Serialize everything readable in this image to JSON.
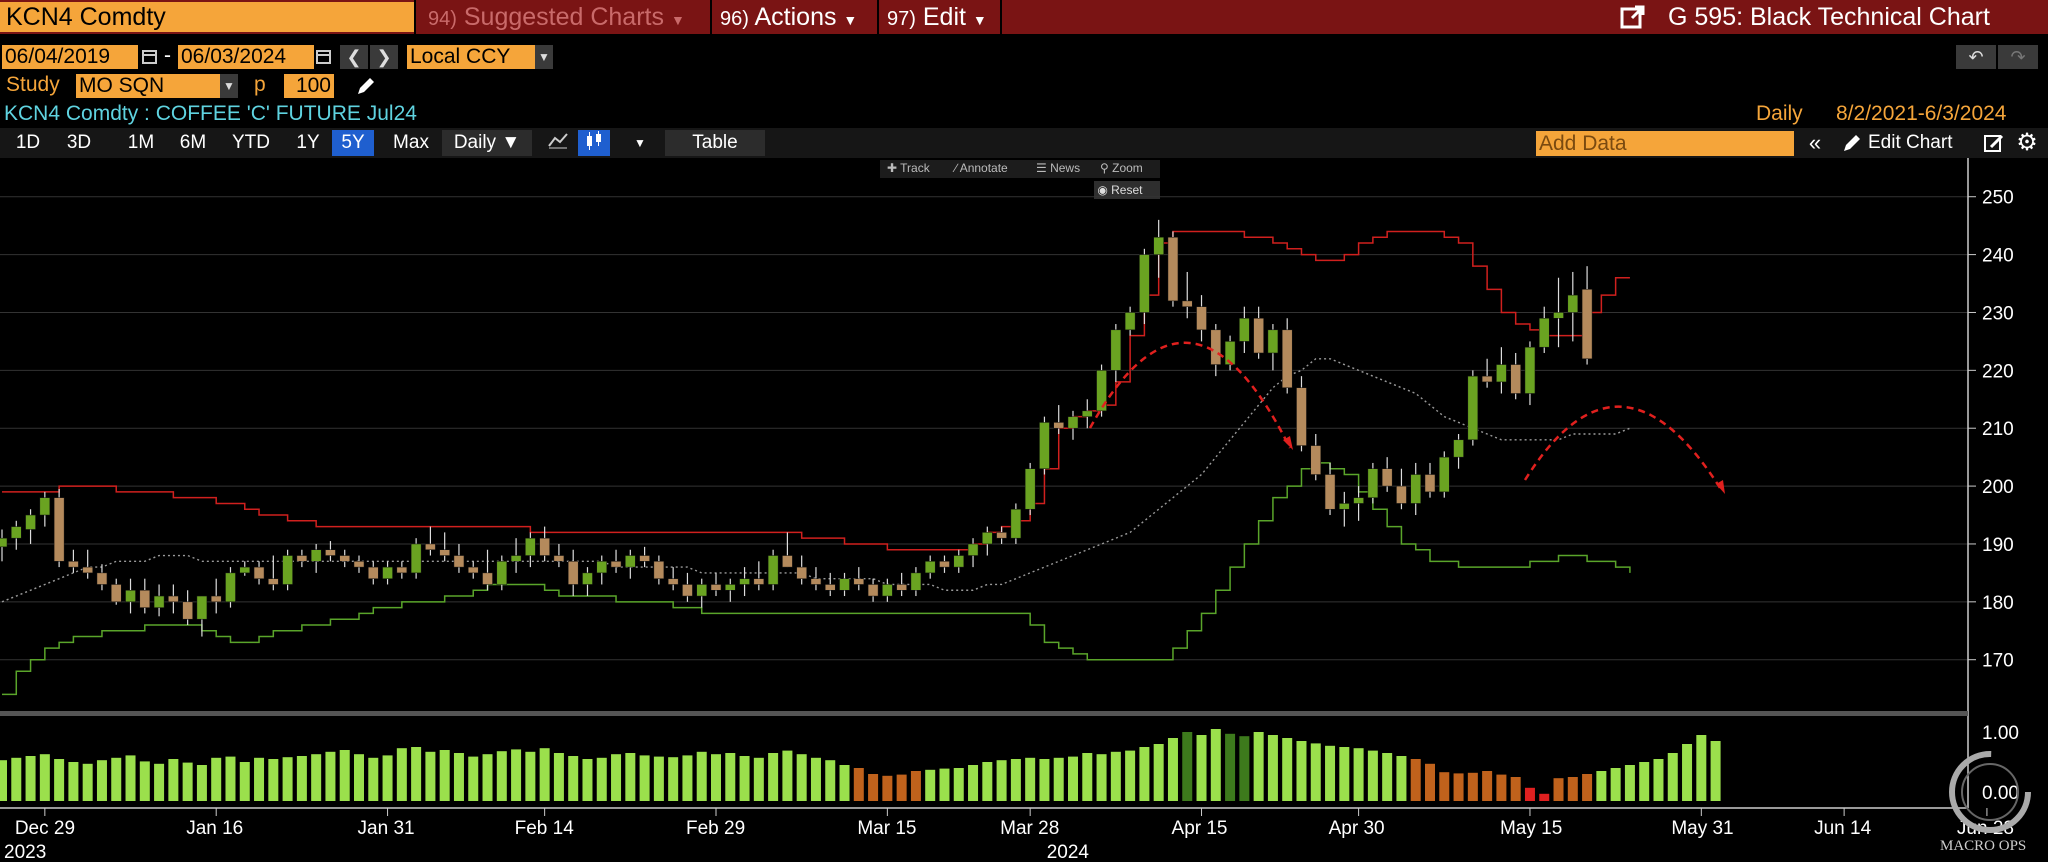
{
  "header": {
    "ticker": "KCN4 Comdty",
    "suggested_num": "94)",
    "suggested_label": "Suggested Charts",
    "actions_num": "96)",
    "actions_label": "Actions",
    "edit_num": "97)",
    "edit_label": "Edit",
    "page_title": "G 595: Black Technical Chart"
  },
  "date_range": {
    "start": "06/04/2019",
    "dash": "-",
    "end": "06/03/2024",
    "currency": "Local CCY"
  },
  "study": {
    "label": "Study",
    "name": "MO SQN",
    "param_label": "p",
    "param_value": "100"
  },
  "security": {
    "description": "KCN4 Comdty : COFFEE 'C' FUTURE Jul24",
    "frequency": "Daily",
    "range": "8/2/2021-6/3/2024"
  },
  "toolbar": {
    "periods": [
      "1D",
      "3D",
      "1M",
      "6M",
      "YTD",
      "1Y",
      "5Y",
      "Max"
    ],
    "selected_period": "5Y",
    "interval": "Daily ▼",
    "table_label": "Table",
    "add_data_placeholder": "Add Data",
    "edit_chart_label": "Edit Chart"
  },
  "chart_tools": {
    "track": "Track",
    "annotate": "Annotate",
    "news": "News",
    "zoom": "Zoom",
    "reset": "Reset"
  },
  "watermark": "MACRO OPS",
  "colors": {
    "up": "#6aa321",
    "down": "#b48a5c",
    "upper_band": "#d0201e",
    "lower_band": "#5aa52a",
    "mid_line": "#9a9a9a",
    "annotation_arc": "#e0201e",
    "volume": "#9be04c",
    "volume_low": "#c0621c"
  },
  "chart_data": {
    "type": "candlestick",
    "y_axis": {
      "ticks": [
        170,
        180,
        190,
        200,
        210,
        220,
        230,
        240,
        250
      ],
      "range": [
        162,
        256
      ]
    },
    "volume_axis": {
      "ticks": [
        "1.00",
        "0.00"
      ]
    },
    "x_ticks": [
      "Dec 29",
      "Jan 16",
      "Jan 31",
      "Feb 14",
      "Feb 29",
      "Mar 15",
      "Mar 28",
      "Apr 15",
      "Apr 30",
      "May 15",
      "May 31",
      "Jun 14",
      "Jun 28"
    ],
    "x_tick_index": [
      3,
      15,
      27,
      38,
      50,
      62,
      72,
      84,
      95,
      107,
      119,
      129,
      139
    ],
    "year_labels": [
      {
        "label": "2023",
        "index": 0
      },
      {
        "label": "2024",
        "index": 74
      }
    ],
    "candles": [
      [
        189.5,
        192.5,
        187,
        191
      ],
      [
        191,
        194,
        189,
        193
      ],
      [
        192.5,
        196,
        190,
        195
      ],
      [
        195,
        199,
        193,
        198
      ],
      [
        198,
        199.5,
        186,
        187
      ],
      [
        187,
        189,
        185,
        186
      ],
      [
        186,
        189,
        184,
        185
      ],
      [
        185,
        186.5,
        182,
        183
      ],
      [
        183,
        184,
        179.5,
        180
      ],
      [
        180,
        184,
        178,
        182
      ],
      [
        182,
        184,
        178,
        179
      ],
      [
        179,
        183,
        177.5,
        181
      ],
      [
        181,
        183,
        178,
        180
      ],
      [
        180,
        182,
        176,
        177
      ],
      [
        177,
        181,
        174,
        181
      ],
      [
        181,
        184,
        178,
        180
      ],
      [
        180,
        186,
        179,
        185
      ],
      [
        185,
        187,
        184.5,
        186
      ],
      [
        186,
        187,
        183,
        184
      ],
      [
        184,
        188,
        182,
        183
      ],
      [
        183,
        189,
        182,
        188
      ],
      [
        188,
        189,
        186,
        187
      ],
      [
        187,
        190,
        185,
        189
      ],
      [
        189,
        190.5,
        187,
        188
      ],
      [
        188,
        189,
        186,
        187
      ],
      [
        187,
        188,
        185,
        186
      ],
      [
        186,
        187,
        183,
        184
      ],
      [
        184,
        187,
        183,
        186
      ],
      [
        186,
        187,
        184,
        185
      ],
      [
        185,
        191,
        184,
        190
      ],
      [
        190,
        193,
        188,
        189
      ],
      [
        189,
        192,
        187,
        188
      ],
      [
        188,
        190,
        185,
        186
      ],
      [
        186,
        187,
        184,
        185
      ],
      [
        185,
        189,
        182,
        183
      ],
      [
        183,
        188,
        182,
        187
      ],
      [
        187,
        191,
        185,
        188
      ],
      [
        188,
        192,
        186,
        191
      ],
      [
        191,
        193,
        187,
        188
      ],
      [
        188,
        190,
        186,
        187
      ],
      [
        187,
        189,
        181,
        183
      ],
      [
        183,
        186,
        181,
        185
      ],
      [
        185,
        188,
        183,
        187
      ],
      [
        187,
        189,
        185,
        186
      ],
      [
        186,
        189,
        184,
        188
      ],
      [
        188,
        189.5,
        186,
        187
      ],
      [
        187,
        188,
        183,
        184
      ],
      [
        184,
        186,
        182,
        183
      ],
      [
        183,
        185,
        180,
        181
      ],
      [
        181,
        184,
        179,
        183
      ],
      [
        183,
        185,
        181,
        182
      ],
      [
        182,
        184,
        180,
        183
      ],
      [
        183,
        186,
        181,
        184
      ],
      [
        184,
        187,
        182,
        183
      ],
      [
        183,
        189,
        182,
        188
      ],
      [
        188,
        192,
        186,
        186
      ],
      [
        186,
        188,
        183,
        184
      ],
      [
        184,
        186,
        182,
        183
      ],
      [
        183,
        185,
        181,
        182
      ],
      [
        182,
        185,
        181,
        184
      ],
      [
        184,
        186,
        182,
        183
      ],
      [
        183,
        184,
        180,
        181
      ],
      [
        181,
        184,
        180,
        183
      ],
      [
        183,
        185,
        181,
        182
      ],
      [
        182,
        186,
        181,
        185
      ],
      [
        185,
        188,
        184,
        187
      ],
      [
        187,
        188,
        185,
        186
      ],
      [
        186,
        189,
        185,
        188
      ],
      [
        188,
        191,
        186,
        190
      ],
      [
        190,
        193,
        188,
        192
      ],
      [
        192,
        193,
        190,
        191
      ],
      [
        191,
        197,
        190,
        196
      ],
      [
        196,
        204,
        195,
        203
      ],
      [
        203,
        212,
        202,
        211
      ],
      [
        211,
        214,
        209,
        210
      ],
      [
        210,
        213,
        208,
        212
      ],
      [
        212,
        215,
        210,
        213
      ],
      [
        213,
        221,
        212,
        220
      ],
      [
        220,
        228,
        218,
        227
      ],
      [
        227,
        231,
        226,
        230
      ],
      [
        230,
        241,
        228,
        240
      ],
      [
        240,
        246,
        236,
        243
      ],
      [
        243,
        244,
        231,
        232
      ],
      [
        232,
        237,
        229,
        231
      ],
      [
        231,
        233,
        225,
        227
      ],
      [
        227,
        228,
        219,
        221
      ],
      [
        221,
        226,
        220,
        225
      ],
      [
        225,
        231,
        223,
        229
      ],
      [
        229,
        231,
        222,
        223
      ],
      [
        223,
        228,
        220,
        227
      ],
      [
        227,
        229,
        216,
        217
      ],
      [
        217,
        219,
        206,
        207
      ],
      [
        207,
        209,
        201,
        202
      ],
      [
        202,
        204,
        195,
        196
      ],
      [
        196,
        199,
        193,
        197
      ],
      [
        197,
        200,
        194,
        198
      ],
      [
        198,
        204,
        197,
        203
      ],
      [
        203,
        205,
        199,
        200
      ],
      [
        200,
        203,
        196,
        197
      ],
      [
        197,
        204,
        195,
        202
      ],
      [
        202,
        204,
        198,
        199
      ],
      [
        199,
        206,
        198,
        205
      ],
      [
        205,
        209,
        203,
        208
      ],
      [
        208,
        220,
        207,
        219
      ],
      [
        219,
        222,
        217,
        218
      ],
      [
        218,
        224,
        216,
        221
      ],
      [
        221,
        223,
        215,
        216
      ],
      [
        216,
        225,
        214,
        224
      ],
      [
        224,
        231,
        223,
        229
      ],
      [
        229,
        236,
        224,
        230
      ],
      [
        230,
        237,
        225,
        233
      ],
      [
        234,
        238,
        221,
        222
      ]
    ],
    "upper_band": [
      199,
      199,
      199,
      199,
      200,
      200,
      200,
      200,
      199,
      199,
      199,
      199,
      198,
      198,
      198,
      197,
      197,
      196,
      195,
      195,
      194,
      194,
      193,
      193,
      193,
      193,
      193,
      193,
      193,
      193,
      193,
      193,
      193,
      193,
      193,
      193,
      193,
      192,
      192,
      192,
      192,
      192,
      192,
      192,
      192,
      192,
      192,
      192,
      192,
      192,
      192,
      192,
      192,
      192,
      192,
      192,
      191,
      191,
      191,
      190,
      190,
      190,
      189,
      189,
      189,
      189,
      189,
      189,
      190,
      192,
      193,
      194,
      197,
      203,
      210,
      212,
      213,
      214,
      218,
      226,
      233,
      242,
      244,
      244,
      244,
      244,
      244,
      243,
      243,
      242,
      241,
      240,
      239,
      239,
      240,
      242,
      243,
      244,
      244,
      244,
      244,
      243,
      242,
      238,
      234,
      230,
      228,
      227,
      226,
      226,
      226,
      230,
      233,
      236,
      236
    ],
    "lower_band": [
      164,
      168,
      170,
      172,
      173,
      174,
      174,
      175,
      175,
      175,
      176,
      176,
      176,
      176,
      175,
      174,
      173,
      173,
      174,
      175,
      175,
      176,
      176,
      177,
      177,
      178,
      179,
      179,
      180,
      180,
      180,
      181,
      181,
      182,
      183,
      183,
      183,
      183,
      182,
      181,
      181,
      181,
      181,
      180,
      180,
      180,
      180,
      179,
      179,
      178,
      178,
      178,
      178,
      178,
      178,
      178,
      178,
      178,
      178,
      178,
      178,
      178,
      178,
      178,
      178,
      178,
      178,
      178,
      178,
      178,
      178,
      178,
      176,
      173,
      172,
      171,
      170,
      170,
      170,
      170,
      170,
      170,
      172,
      175,
      178,
      182,
      186,
      190,
      194,
      198,
      200,
      203,
      204,
      203,
      202,
      199,
      196,
      193,
      190,
      189,
      187,
      187,
      186,
      186,
      186,
      186,
      186,
      187,
      187,
      188,
      188,
      187,
      187,
      186,
      185
    ],
    "mid_line": [
      180,
      181,
      182,
      183,
      184,
      185,
      186,
      186,
      187,
      187,
      187,
      188,
      188,
      188,
      187,
      187,
      187,
      187,
      187,
      187,
      187,
      187,
      187,
      187,
      187,
      187,
      187,
      187,
      187,
      187,
      187,
      187,
      187,
      187,
      187,
      187,
      187,
      187,
      187,
      187,
      187,
      187,
      187,
      186,
      186,
      186,
      186,
      186,
      186,
      185,
      185,
      185,
      185,
      185,
      185,
      185,
      185,
      184,
      184,
      184,
      184,
      184,
      183,
      183,
      183,
      183,
      182,
      182,
      182,
      183,
      183,
      184,
      185,
      186,
      187,
      188,
      189,
      190,
      191,
      192,
      194,
      196,
      198,
      200,
      202,
      205,
      208,
      211,
      214,
      217,
      219,
      220,
      222,
      222,
      221,
      220,
      219,
      218,
      217,
      216,
      214,
      212,
      211,
      210,
      209,
      208,
      208,
      208,
      208,
      208,
      209,
      209,
      209,
      209,
      210
    ],
    "volume": [
      0.68,
      0.72,
      0.75,
      0.78,
      0.7,
      0.65,
      0.62,
      0.68,
      0.72,
      0.76,
      0.66,
      0.62,
      0.7,
      0.64,
      0.6,
      0.72,
      0.74,
      0.65,
      0.72,
      0.7,
      0.73,
      0.75,
      0.78,
      0.82,
      0.85,
      0.78,
      0.72,
      0.76,
      0.88,
      0.9,
      0.82,
      0.85,
      0.8,
      0.74,
      0.78,
      0.83,
      0.86,
      0.82,
      0.88,
      0.8,
      0.75,
      0.7,
      0.72,
      0.78,
      0.8,
      0.76,
      0.74,
      0.73,
      0.76,
      0.82,
      0.78,
      0.8,
      0.75,
      0.72,
      0.8,
      0.84,
      0.78,
      0.72,
      0.68,
      0.6,
      0.55,
      0.45,
      0.42,
      0.44,
      0.5,
      0.52,
      0.54,
      0.55,
      0.6,
      0.65,
      0.68,
      0.7,
      0.72,
      0.7,
      0.72,
      0.74,
      0.8,
      0.78,
      0.82,
      0.84,
      0.9,
      0.95,
      1.05,
      1.15,
      1.1,
      1.2,
      1.12,
      1.08,
      1.15,
      1.1,
      1.05,
      1.0,
      0.96,
      0.92,
      0.9,
      0.88,
      0.84,
      0.8,
      0.75,
      0.7,
      0.62,
      0.48,
      0.46,
      0.47,
      0.5,
      0.44,
      0.4,
      0.22,
      0.12,
      0.38,
      0.4,
      0.45,
      0.5,
      0.55,
      0.6,
      0.65,
      0.7,
      0.8,
      0.95,
      1.1,
      1.0
    ],
    "volume_highlight_dark": [
      83,
      86,
      87
    ],
    "volume_low_index": [
      60,
      61,
      62,
      63,
      64,
      99,
      100,
      101,
      102,
      103,
      104,
      105,
      106,
      108,
      109,
      110,
      111
    ],
    "volume_red_index": [
      107,
      108
    ]
  }
}
